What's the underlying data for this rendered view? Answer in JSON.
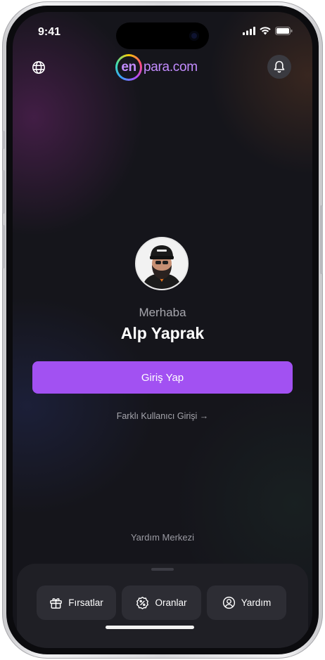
{
  "status_bar": {
    "time": "9:41"
  },
  "header": {
    "logo_en": "en",
    "logo_text": "para.com",
    "globe_icon": "globe-icon",
    "bell_icon": "bell-icon"
  },
  "profile": {
    "greeting": "Merhaba",
    "name": "Alp Yaprak"
  },
  "actions": {
    "login_label": "Giriş Yap",
    "alt_login_label": "Farklı Kullanıcı Girişi →",
    "help_center_label": "Yardım Merkezi"
  },
  "tabs": [
    {
      "label": "Fırsatlar",
      "icon": "gift-icon"
    },
    {
      "label": "Oranlar",
      "icon": "percent-badge-icon"
    },
    {
      "label": "Yardım",
      "icon": "user-circle-icon"
    }
  ],
  "colors": {
    "accent": "#a251f2",
    "background": "#15151b",
    "tab_bg": "#2d2d34"
  }
}
